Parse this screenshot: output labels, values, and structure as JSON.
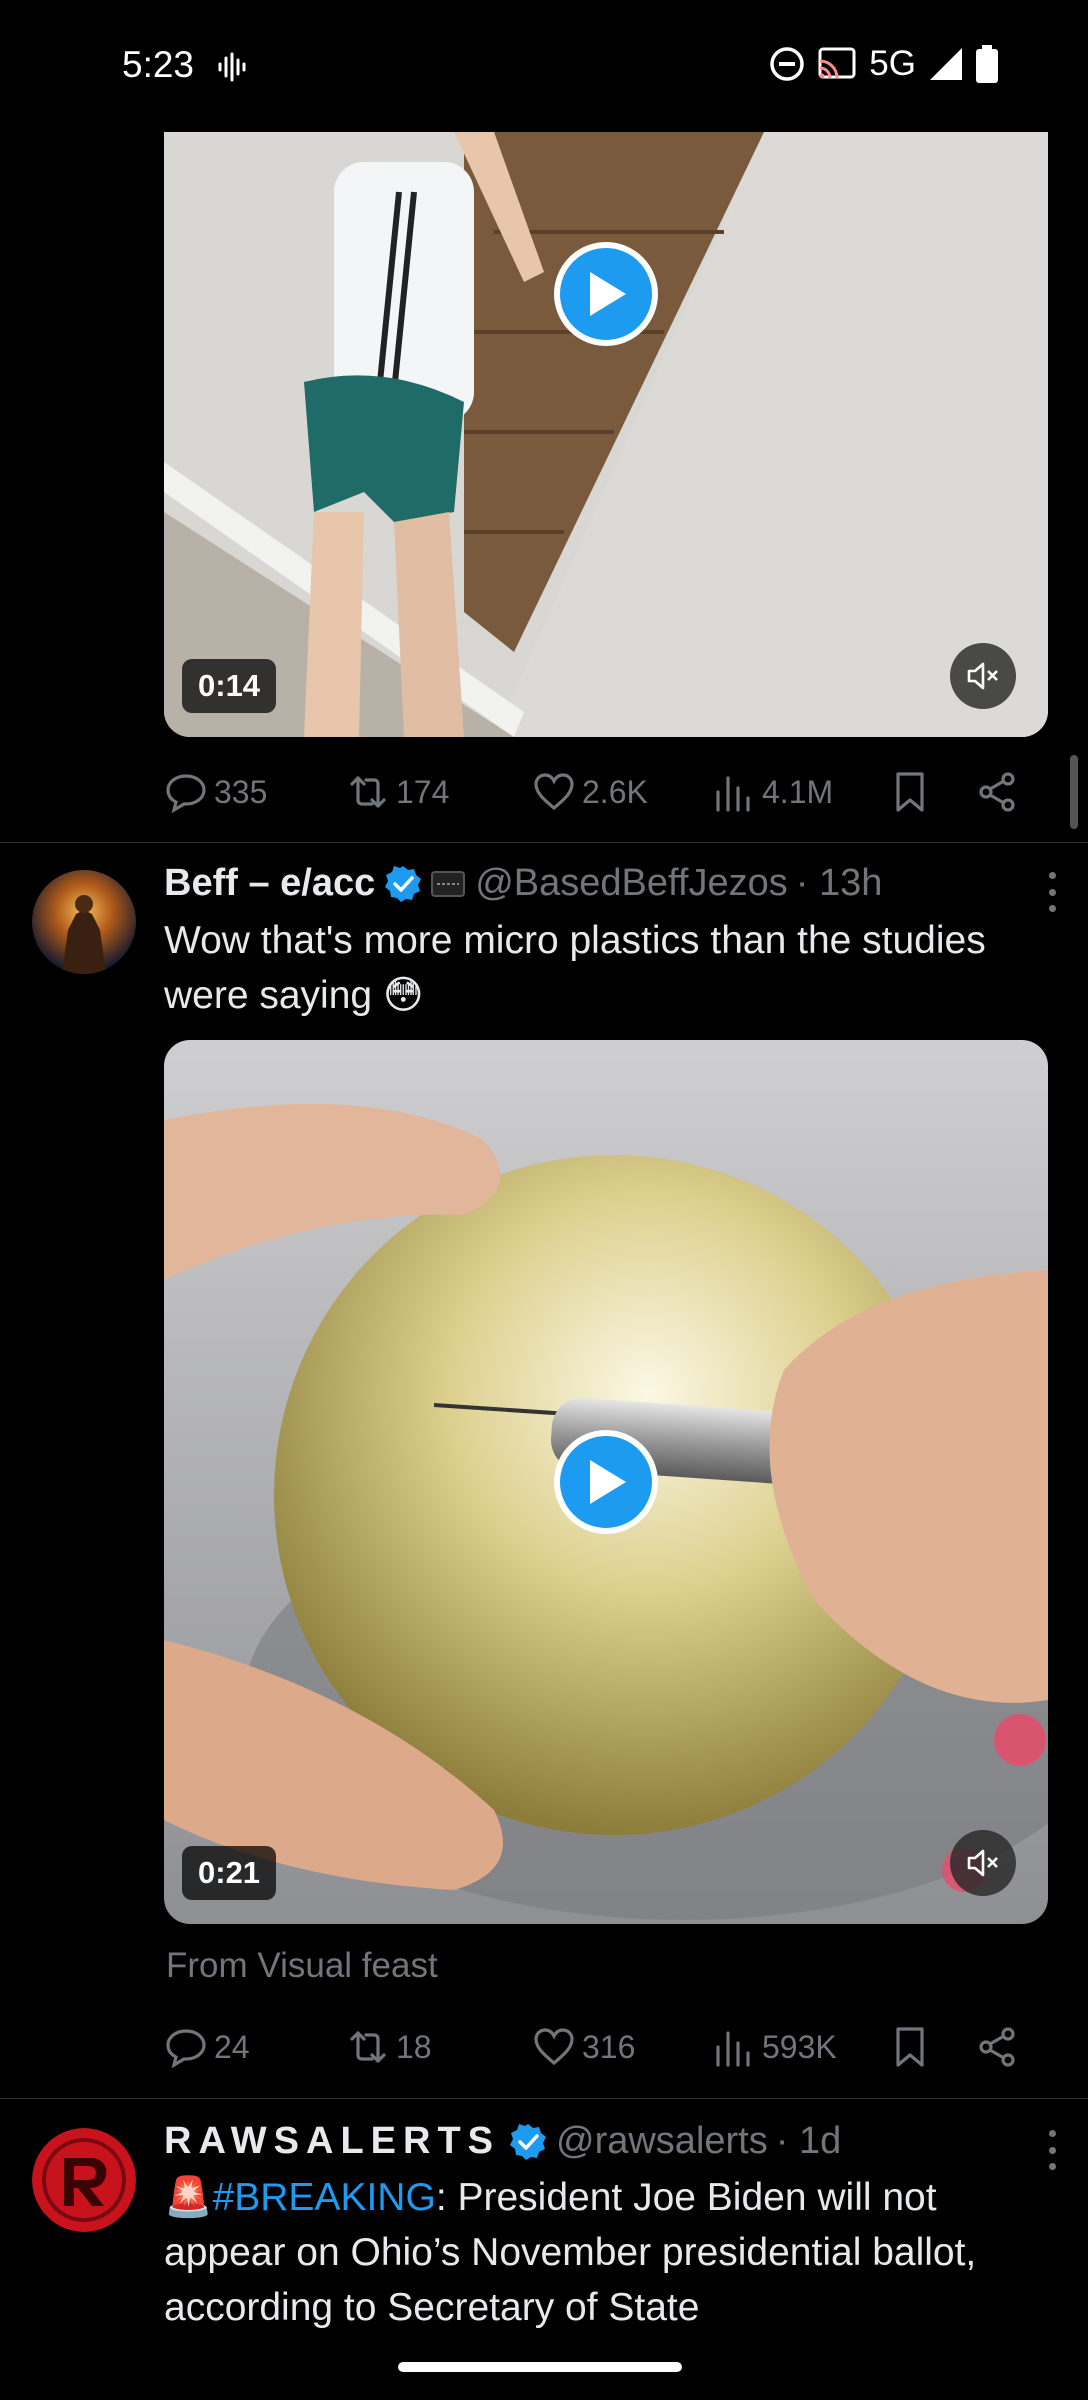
{
  "status_bar": {
    "time": "5:23",
    "network": "5G",
    "icons": [
      "sound-wave-icon",
      "do-not-disturb-icon",
      "cast-icon",
      "signal-icon",
      "battery-icon"
    ]
  },
  "tweets": [
    {
      "video_duration": "0:14",
      "actions": {
        "replies": "335",
        "reposts": "174",
        "likes": "2.6K",
        "views": "4.1M"
      }
    },
    {
      "display_name": "Beff – e/acc",
      "handle": "@BasedBeffJezos",
      "time": "· 13h",
      "text": "Wow that's more micro plastics than the studies were saying 😳",
      "video_duration": "0:21",
      "source": "From Visual feast",
      "actions": {
        "replies": "24",
        "reposts": "18",
        "likes": "316",
        "views": "593K"
      }
    },
    {
      "display_name": "RAWSALERTS",
      "handle": "@rawsalerts",
      "time": "· 1d",
      "text_emoji": "🚨",
      "hashtag": "#BREAKING",
      "text": ": President Joe Biden will not appear on Ohio’s November presidential ballot, according to Secretary of State"
    }
  ],
  "colors": {
    "accent": "#1d9bf0",
    "muted": "#71767b",
    "background": "#000000",
    "divider": "#2f3336"
  }
}
